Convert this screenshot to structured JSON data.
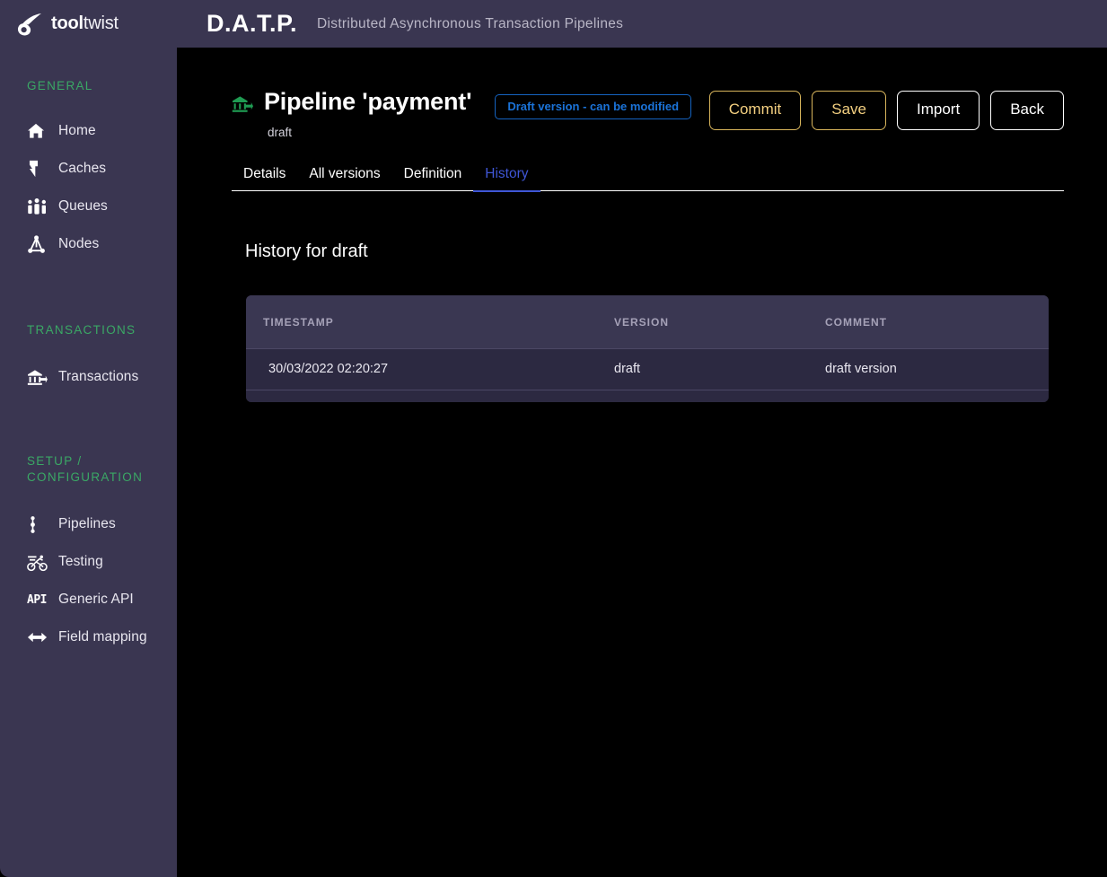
{
  "brand": {
    "logo_icon": "comet-logo-icon",
    "name_bold": "tool",
    "name_light": "twist"
  },
  "topbar": {
    "app_abbrev": "D.A.T.P.",
    "app_subtitle": "Distributed Asynchronous Transaction Pipelines"
  },
  "sidebar": {
    "sections": [
      {
        "title": "GENERAL",
        "items": [
          {
            "label": "Home",
            "icon": "home-icon"
          },
          {
            "label": "Caches",
            "icon": "lightning-bolt-icon"
          },
          {
            "label": "Queues",
            "icon": "people-group-icon"
          },
          {
            "label": "Nodes",
            "icon": "network-nodes-icon"
          }
        ]
      },
      {
        "title": "TRANSACTIONS",
        "items": [
          {
            "label": "Transactions",
            "icon": "bank-transfer-icon"
          }
        ]
      },
      {
        "title": "SETUP / CONFIGURATION",
        "items": [
          {
            "label": "Pipelines",
            "icon": "pipeline-nodes-icon"
          },
          {
            "label": "Testing",
            "icon": "cyclist-icon"
          },
          {
            "label": "Generic API",
            "icon": "api-icon"
          },
          {
            "label": "Field mapping",
            "icon": "left-right-arrow-icon"
          }
        ]
      }
    ]
  },
  "page": {
    "icon": "bank-transfer-icon",
    "title": "Pipeline 'payment'",
    "subtitle": "draft",
    "status_badge": "Draft version - can be modified",
    "buttons": [
      {
        "label": "Commit",
        "style": "gold"
      },
      {
        "label": "Save",
        "style": "gold"
      },
      {
        "label": "Import",
        "style": "white"
      },
      {
        "label": "Back",
        "style": "white"
      }
    ],
    "tabs": [
      {
        "label": "Details",
        "active": false
      },
      {
        "label": "All versions",
        "active": false
      },
      {
        "label": "Definition",
        "active": false
      },
      {
        "label": "History",
        "active": true
      }
    ],
    "section_heading": "History for draft"
  },
  "history_table": {
    "columns": [
      "TIMESTAMP",
      "VERSION",
      "COMMENT"
    ],
    "rows": [
      {
        "timestamp": "30/03/2022 02:20:27",
        "version": "draft",
        "comment": "draft version"
      }
    ]
  },
  "colors": {
    "sidebar_bg": "#3a3651",
    "main_bg": "#000000",
    "section_title": "#3aa865",
    "badge_blue": "#1b73d8",
    "active_tab": "#3f56d6",
    "gold_button": "#f3cf80",
    "table_header_bg": "#3a3752",
    "table_row_bg": "#2c2941"
  }
}
